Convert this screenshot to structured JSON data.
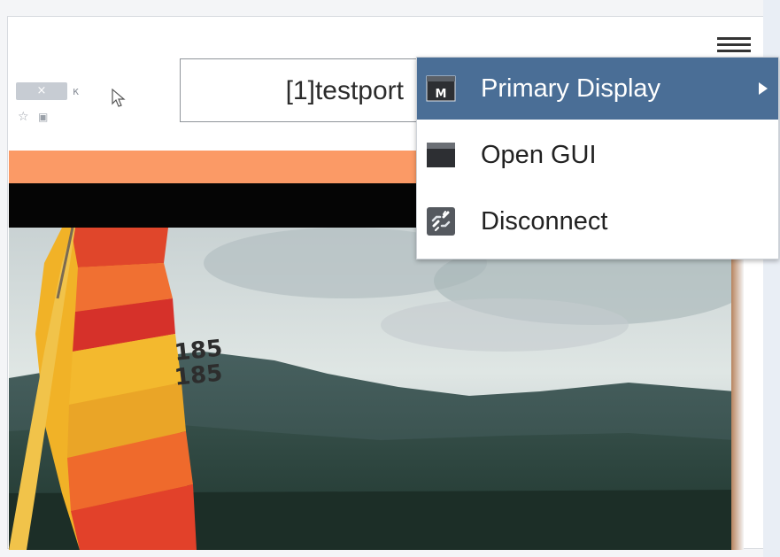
{
  "window": {
    "port_label": "[1]testport",
    "mini_close_label": "×",
    "mini_k_label": "к"
  },
  "menu": {
    "items": [
      {
        "label": "Primary Display",
        "icon": "monitor-m-icon",
        "has_submenu": true
      },
      {
        "label": "Open GUI",
        "icon": "window-icon",
        "has_submenu": false
      },
      {
        "label": "Disconnect",
        "icon": "broken-link-icon",
        "has_submenu": false
      }
    ]
  },
  "video": {
    "sail_numbers": [
      "185",
      "185"
    ]
  },
  "colors": {
    "menu_highlight": "#4a6e96",
    "orange_bar": "#fb9a66",
    "palette": [
      "#000000",
      "#6b3b3b",
      "#b2342a",
      "#d86532",
      "#e8a33a",
      "#d5c935",
      "#66b24a",
      "#3b9a55",
      "#3a8fbf",
      "#3f5fa8",
      "#6b4f9a",
      "#9a4f88"
    ]
  }
}
